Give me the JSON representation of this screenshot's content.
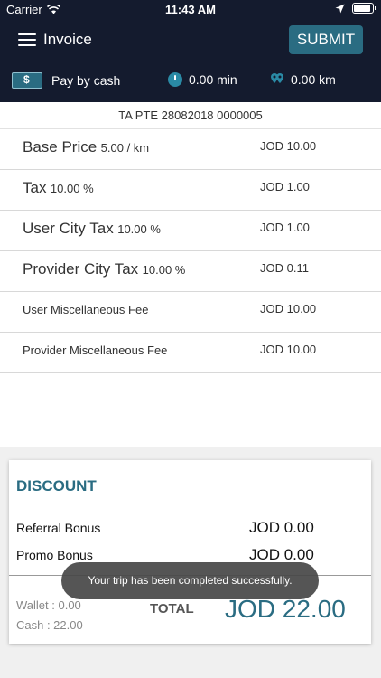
{
  "status_bar": {
    "carrier": "Carrier",
    "time": "11:43 AM"
  },
  "nav": {
    "title": "Invoice",
    "submit_label": "SUBMIT"
  },
  "trip_info": {
    "payment": "Pay by cash",
    "duration": "0.00 min",
    "distance": "0.00 km"
  },
  "booking_id": "TA PTE 28082018 0000005",
  "invoice_rows": [
    {
      "label": "Base Price",
      "rate": "5.00 / km",
      "value": "JOD 10.00"
    },
    {
      "label": "Tax",
      "rate": "10.00 %",
      "value": "JOD 1.00"
    },
    {
      "label": "User City Tax",
      "rate": "10.00 %",
      "value": "JOD 1.00"
    },
    {
      "label": "Provider City Tax",
      "rate": "10.00 %",
      "value": "JOD 0.11"
    },
    {
      "label": "User Miscellaneous Fee",
      "value": "JOD 10.00"
    },
    {
      "label": "Provider Miscellaneous Fee",
      "value": "JOD 10.00"
    }
  ],
  "discount": {
    "title": "DISCOUNT",
    "referral_label": "Referral Bonus",
    "referral_value": "JOD 0.00",
    "promo_label": "Promo Bonus",
    "promo_value": "JOD 0.00"
  },
  "totals": {
    "wallet": "Wallet : 0.00",
    "cash": "Cash : 22.00",
    "total_label": "TOTAL",
    "total_value": "JOD 22.00"
  },
  "toast": "Your trip has been completed successfully.",
  "colors": {
    "header_bg": "#141b2e",
    "accent": "#2a6c82"
  }
}
